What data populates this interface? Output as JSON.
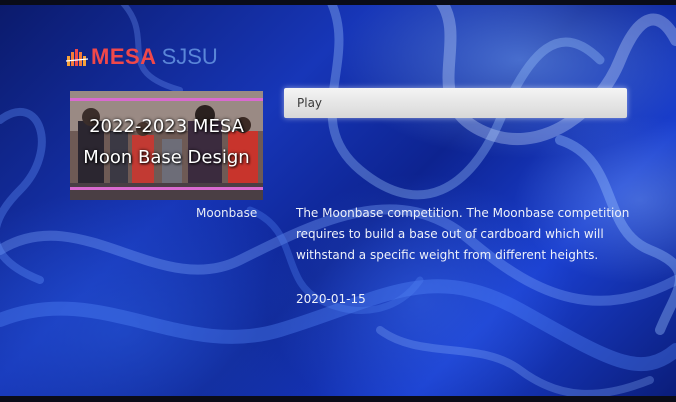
{
  "logo": {
    "brand_primary": "MESA",
    "brand_secondary": "SJSU"
  },
  "video": {
    "thumbnail_title_line1": "2022-2023 MESA",
    "thumbnail_title_line2": "Moon Base Design",
    "label": "Moonbase",
    "description": "The Moonbase competition. The Moonbase competition requires to build a base out of cardboard which will withstand a specific weight from different heights.",
    "date": "2020-01-15"
  },
  "actions": {
    "play_label": "Play"
  },
  "colors": {
    "brand_red": "#f0484a",
    "brand_blue": "#5a86d8",
    "background": "#1736b8",
    "button_bg": "#e8e8e8",
    "thumbnail_stripe": "#d96ad0"
  }
}
